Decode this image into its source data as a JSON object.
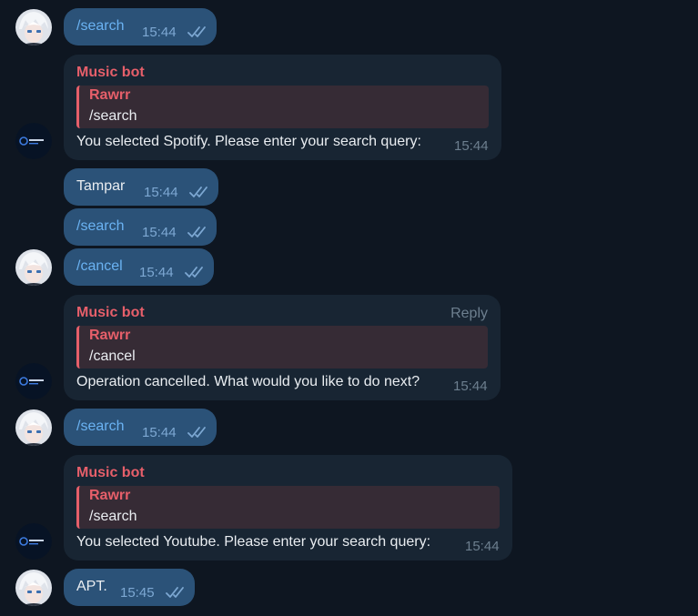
{
  "chat": {
    "messages": [
      {
        "type": "outgoing",
        "text": "/search",
        "time": "15:44",
        "status_icon": "double-check-icon"
      },
      {
        "type": "incoming",
        "sender": "Music bot",
        "quote": {
          "name": "Rawrr",
          "text": "/search"
        },
        "text": "You selected Spotify. Please enter your search query:",
        "time": "15:44"
      },
      {
        "type": "outgoing",
        "text": "Tampar",
        "time": "15:44",
        "status_icon": "double-check-icon"
      },
      {
        "type": "outgoing",
        "text": "/search",
        "time": "15:44",
        "status_icon": "double-check-icon"
      },
      {
        "type": "outgoing",
        "text": "/cancel",
        "time": "15:44",
        "status_icon": "double-check-icon"
      },
      {
        "type": "incoming",
        "sender": "Music bot",
        "reply_label": "Reply",
        "quote": {
          "name": "Rawrr",
          "text": "/cancel"
        },
        "text": "Operation cancelled. What would you like to do next?",
        "time": "15:44"
      },
      {
        "type": "outgoing",
        "text": "/search",
        "time": "15:44",
        "status_icon": "double-check-icon"
      },
      {
        "type": "incoming",
        "sender": "Music bot",
        "quote": {
          "name": "Rawrr",
          "text": "/search"
        },
        "text": "You selected Youtube. Please enter your search query:",
        "time": "15:44"
      },
      {
        "type": "outgoing",
        "text": "APT.",
        "time": "15:45",
        "status_icon": "double-check-icon"
      }
    ]
  },
  "colors": {
    "background": "#0e1621",
    "outgoing_bubble": "#2b5278",
    "incoming_bubble": "#182533",
    "bot_name": "#e65f6a",
    "command_link": "#6ab2f2",
    "quote_background": "#362b35"
  }
}
